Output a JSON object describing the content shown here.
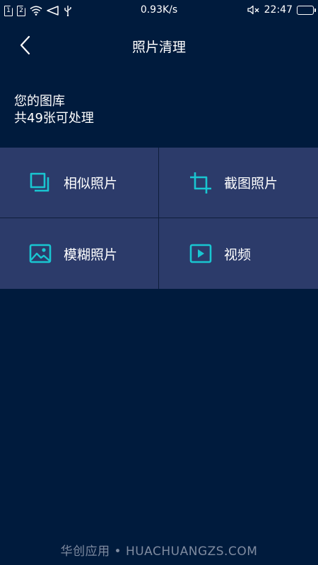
{
  "status_bar": {
    "sim1": "1",
    "sim2": "2",
    "network_speed": "0.93K/s",
    "time": "22:47",
    "battery_color": "#1ed97a"
  },
  "header": {
    "title": "照片清理",
    "back_icon": "chevron-left-icon"
  },
  "summary": {
    "line1": "您的图库",
    "line2": "共49张可处理"
  },
  "categories": [
    {
      "label": "相似照片",
      "icon": "similar-photos-icon"
    },
    {
      "label": "截图照片",
      "icon": "crop-icon"
    },
    {
      "label": "模糊照片",
      "icon": "image-icon"
    },
    {
      "label": "视频",
      "icon": "video-play-icon"
    }
  ],
  "watermark": "华创应用 • HUACHUANGZS.COM",
  "colors": {
    "background": "#001b3d",
    "tile": "#2c3b6a",
    "accent": "#19c6d1"
  }
}
